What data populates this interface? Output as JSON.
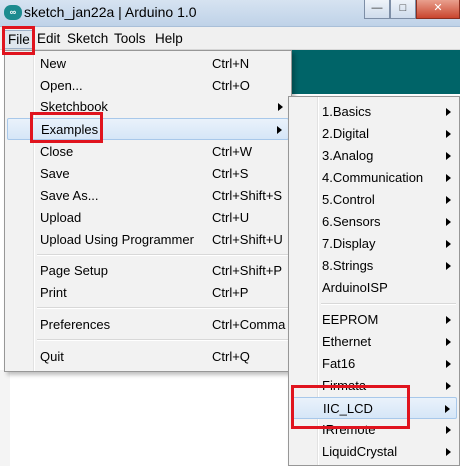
{
  "window": {
    "title": "sketch_jan22a | Arduino 1.0",
    "icon": "arduino-icon",
    "controls": [
      "minimize-icon",
      "maximize-icon",
      "close-icon"
    ]
  },
  "menubar": [
    "File",
    "Edit",
    "Sketch",
    "Tools",
    "Help"
  ],
  "file_menu": [
    {
      "label": "New",
      "shortcut": "Ctrl+N"
    },
    {
      "label": "Open...",
      "shortcut": "Ctrl+O"
    },
    {
      "label": "Sketchbook",
      "shortcut": ""
    },
    {
      "label": "Examples",
      "shortcut": ""
    },
    {
      "label": "Close",
      "shortcut": "Ctrl+W"
    },
    {
      "label": "Save",
      "shortcut": "Ctrl+S"
    },
    {
      "label": "Save As...",
      "shortcut": "Ctrl+Shift+S"
    },
    {
      "label": "Upload",
      "shortcut": "Ctrl+U"
    },
    {
      "label": "Upload Using Programmer",
      "shortcut": "Ctrl+Shift+U"
    },
    {
      "label": "Page Setup",
      "shortcut": "Ctrl+Shift+P"
    },
    {
      "label": "Print",
      "shortcut": "Ctrl+P"
    },
    {
      "label": "Preferences",
      "shortcut": "Ctrl+Comma"
    },
    {
      "label": "Quit",
      "shortcut": "Ctrl+Q"
    }
  ],
  "examples_menu": [
    "1.Basics",
    "2.Digital",
    "3.Analog",
    "4.Communication",
    "5.Control",
    "6.Sensors",
    "7.Display",
    "8.Strings",
    "ArduinoISP",
    "EEPROM",
    "Ethernet",
    "Fat16",
    "Firmata",
    "IIC_LCD",
    "IRremote",
    "LiquidCrystal"
  ],
  "highlight_color": "#e0141e",
  "accent_color": "#006468"
}
